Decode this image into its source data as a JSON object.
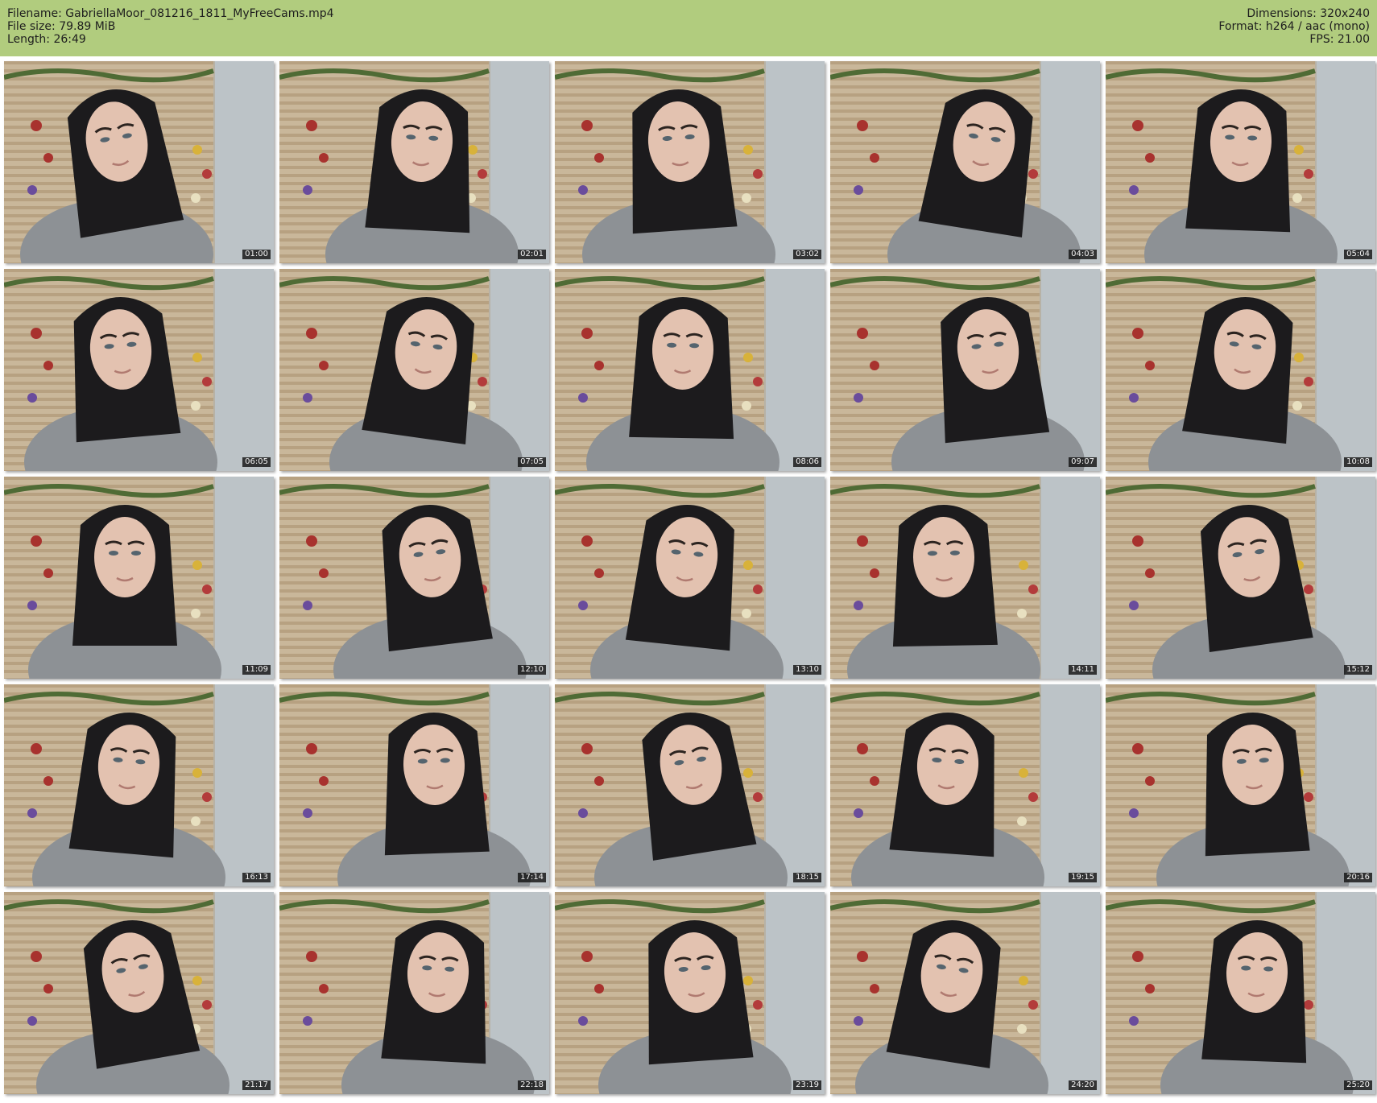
{
  "header": {
    "left": [
      "Filename: GabriellaMoor_081216_1811_MyFreeCams.mp4",
      "File size: 79.89 MiB",
      "Length: 26:49"
    ],
    "right": [
      "Dimensions: 320x240",
      "Format: h264 / aac (mono)",
      "FPS: 21.00"
    ]
  },
  "colors": {
    "header_bg": "#b1cc7e",
    "timestamp_bg": "#0f0f0f",
    "timestamp_text": "#f2f2f2"
  },
  "thumbnails": [
    {
      "time": "01:00"
    },
    {
      "time": "02:01"
    },
    {
      "time": "03:02"
    },
    {
      "time": "04:03"
    },
    {
      "time": "05:04"
    },
    {
      "time": "06:05"
    },
    {
      "time": "07:05"
    },
    {
      "time": "08:06"
    },
    {
      "time": "09:07"
    },
    {
      "time": "10:08"
    },
    {
      "time": "11:09"
    },
    {
      "time": "12:10"
    },
    {
      "time": "13:10"
    },
    {
      "time": "14:11"
    },
    {
      "time": "15:12"
    },
    {
      "time": "16:13"
    },
    {
      "time": "17:14"
    },
    {
      "time": "18:15"
    },
    {
      "time": "19:15"
    },
    {
      "time": "20:16"
    },
    {
      "time": "21:17"
    },
    {
      "time": "22:18"
    },
    {
      "time": "23:19"
    },
    {
      "time": "24:20"
    },
    {
      "time": "25:20"
    }
  ]
}
